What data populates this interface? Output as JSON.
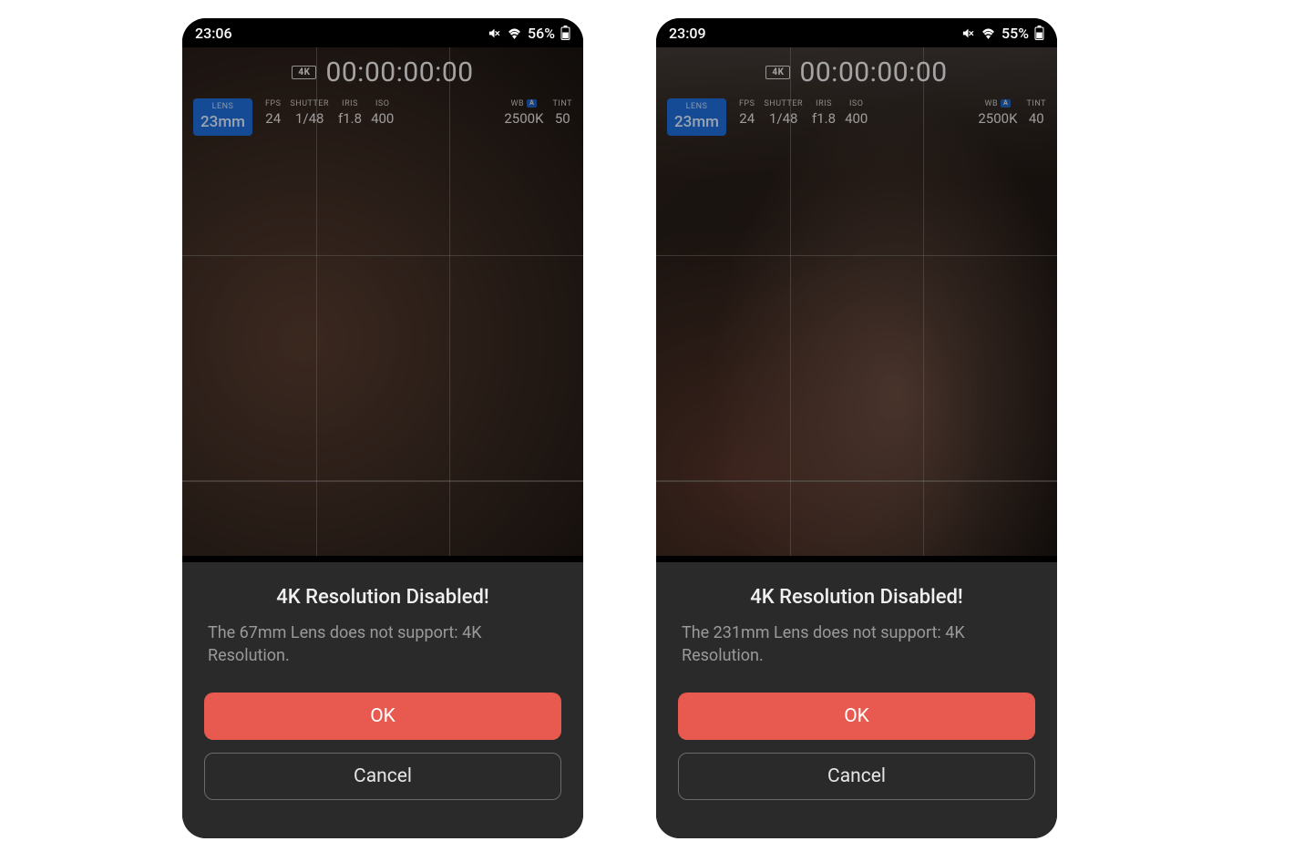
{
  "screens": [
    {
      "status": {
        "time": "23:06",
        "battery": "56%"
      },
      "badge4k": "4K",
      "timecode": "00:00:00:00",
      "params": {
        "lens": {
          "label": "LENS",
          "value": "23mm"
        },
        "fps": {
          "label": "FPS",
          "value": "24"
        },
        "shutter": {
          "label": "SHUTTER",
          "value": "1/48"
        },
        "iris": {
          "label": "IRIS",
          "value": "f1.8"
        },
        "iso": {
          "label": "ISO",
          "value": "400"
        },
        "wb": {
          "label": "WB",
          "value": "2500K",
          "auto_badge": "A"
        },
        "tint": {
          "label": "TINT",
          "value": "50"
        }
      },
      "dialog": {
        "title": "4K Resolution Disabled!",
        "message": "The 67mm Lens does not support: 4K Resolution.",
        "ok": "OK",
        "cancel": "Cancel"
      }
    },
    {
      "status": {
        "time": "23:09",
        "battery": "55%"
      },
      "badge4k": "4K",
      "timecode": "00:00:00:00",
      "params": {
        "lens": {
          "label": "LENS",
          "value": "23mm"
        },
        "fps": {
          "label": "FPS",
          "value": "24"
        },
        "shutter": {
          "label": "SHUTTER",
          "value": "1/48"
        },
        "iris": {
          "label": "IRIS",
          "value": "f1.8"
        },
        "iso": {
          "label": "ISO",
          "value": "400"
        },
        "wb": {
          "label": "WB",
          "value": "2500K",
          "auto_badge": "A"
        },
        "tint": {
          "label": "TINT",
          "value": "40"
        }
      },
      "dialog": {
        "title": "4K Resolution Disabled!",
        "message": "The 231mm Lens does not support: 4K Resolution.",
        "ok": "OK",
        "cancel": "Cancel"
      }
    }
  ]
}
